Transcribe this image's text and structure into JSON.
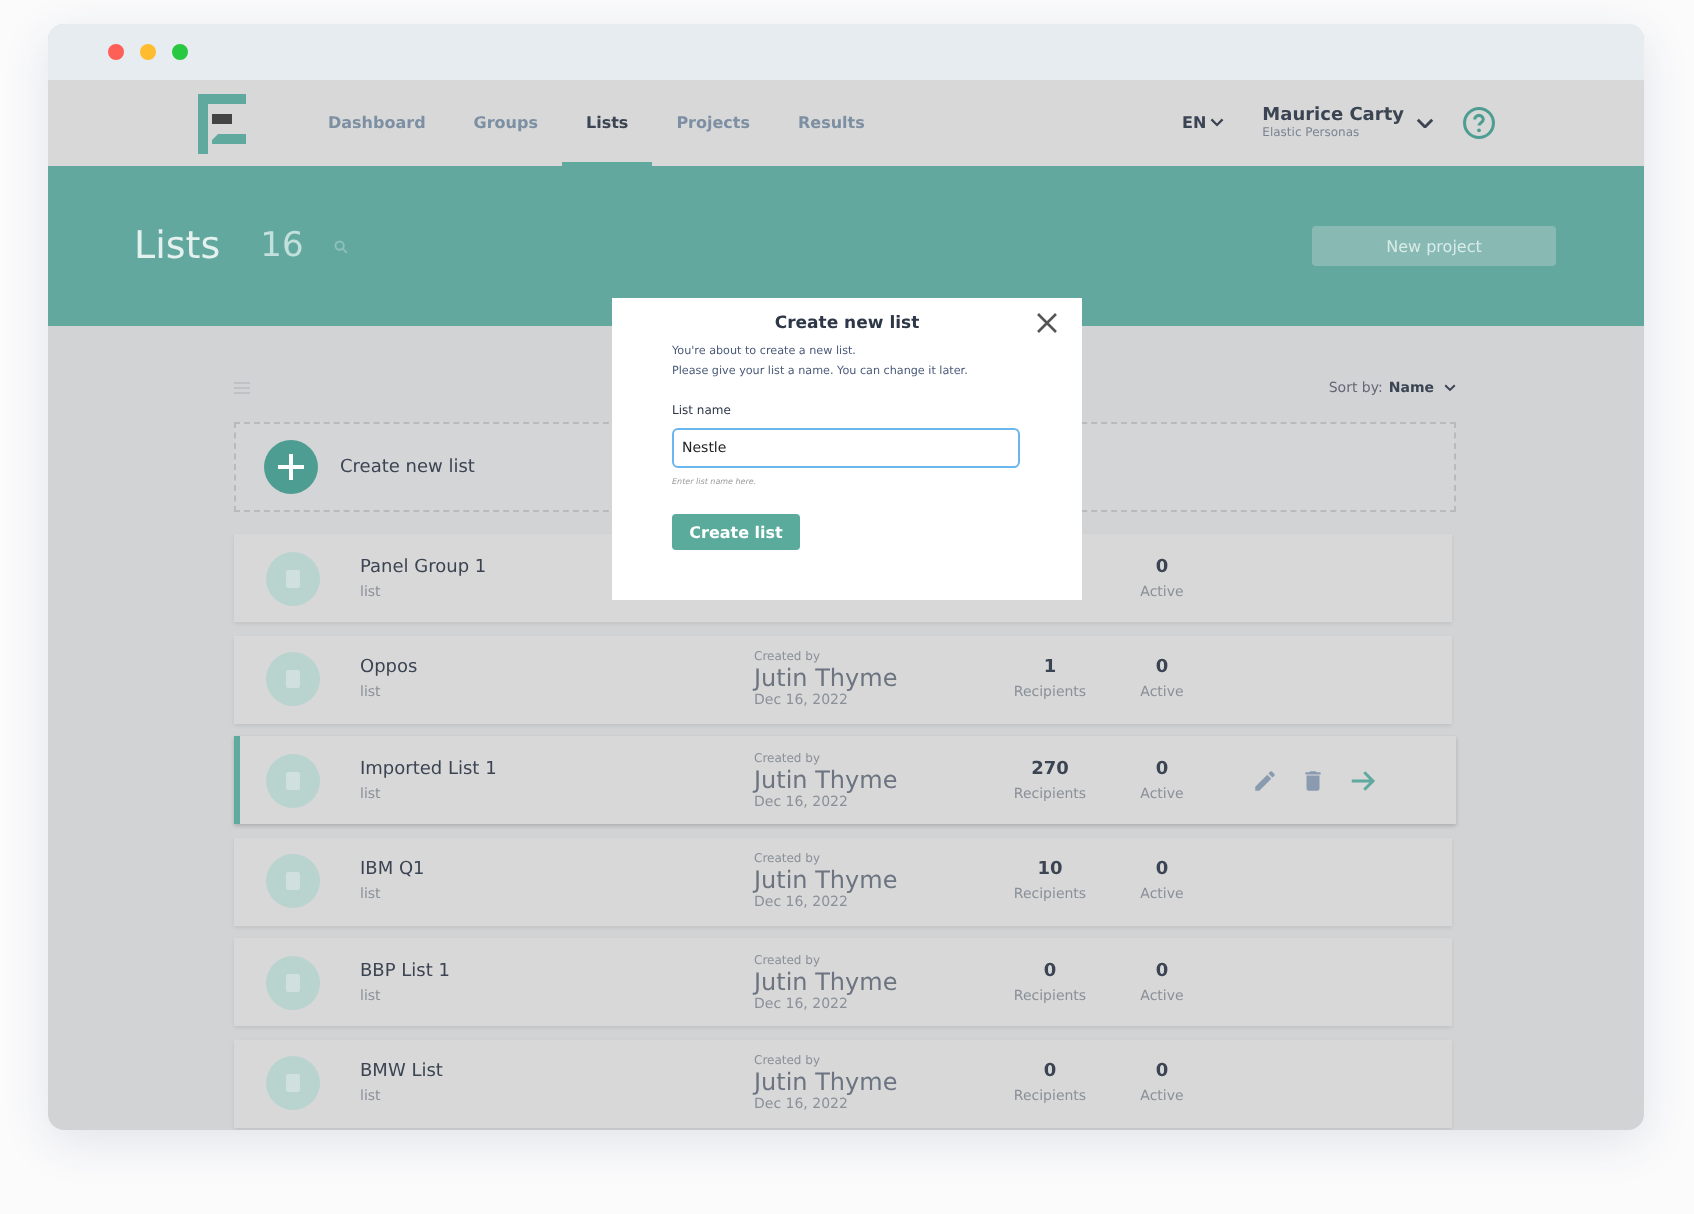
{
  "nav": {
    "tabs": [
      {
        "label": "Dashboard",
        "selected": false
      },
      {
        "label": "Groups",
        "selected": false
      },
      {
        "label": "Lists",
        "selected": true
      },
      {
        "label": "Projects",
        "selected": false
      },
      {
        "label": "Results",
        "selected": false
      }
    ],
    "language": "EN",
    "user": {
      "name": "Maurice Carty",
      "organization": "Elastic Personas"
    }
  },
  "header": {
    "title": "Lists",
    "count": "16",
    "new_button": "New project"
  },
  "sort": {
    "label": "Sort by:",
    "value": "Name"
  },
  "create_card": {
    "label": "Create new list"
  },
  "rows": [
    {
      "name": "Panel Group 1",
      "type": "list",
      "active": "0",
      "active_label": "Active",
      "selected": false
    },
    {
      "name": "Oppos",
      "type": "list",
      "created_label": "Created by",
      "creator": "Jutin Thyme",
      "date": "Dec 16, 2022",
      "recipients": "1",
      "recipients_label": "Recipients",
      "active": "0",
      "active_label": "Active",
      "selected": false
    },
    {
      "name": "Imported List 1",
      "type": "list",
      "created_label": "Created by",
      "creator": "Jutin Thyme",
      "date": "Dec 16, 2022",
      "recipients": "270",
      "recipients_label": "Recipients",
      "active": "0",
      "active_label": "Active",
      "selected": true
    },
    {
      "name": "IBM Q1",
      "type": "list",
      "created_label": "Created by",
      "creator": "Jutin Thyme",
      "date": "Dec 16, 2022",
      "recipients": "10",
      "recipients_label": "Recipients",
      "active": "0",
      "active_label": "Active",
      "selected": false
    },
    {
      "name": "BBP List 1",
      "type": "list",
      "created_label": "Created by",
      "creator": "Jutin Thyme",
      "date": "Dec 16, 2022",
      "recipients": "0",
      "recipients_label": "Recipients",
      "active": "0",
      "active_label": "Active",
      "selected": false
    },
    {
      "name": "BMW List",
      "type": "list",
      "created_label": "Created by",
      "creator": "Jutin Thyme",
      "date": "Dec 16, 2022",
      "recipients": "0",
      "recipients_label": "Recipients",
      "active": "0",
      "active_label": "Active",
      "selected": false
    }
  ],
  "modal": {
    "title": "Create new list",
    "intro": [
      "You're about to create a new list.",
      "Please give your list a name. You can change it later."
    ],
    "field_label": "List name",
    "value": "Nestle",
    "hint": "Enter list name here.",
    "submit": "Create list"
  }
}
